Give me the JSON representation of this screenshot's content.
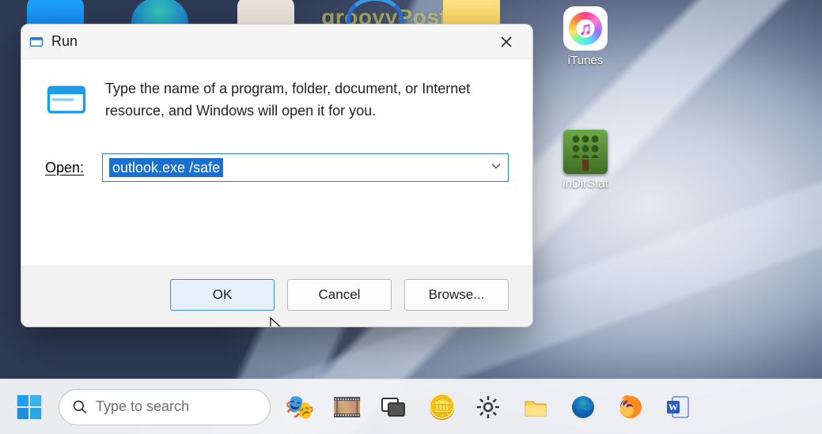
{
  "watermark": "groovyPost.com",
  "desktop_icons": {
    "itunes": "iTunes",
    "windirstat": "inDirStat"
  },
  "run_dialog": {
    "title": "Run",
    "description": "Type the name of a program, folder, document, or Internet resource, and Windows will open it for you.",
    "open_label": "Open:",
    "command_value": "outlook.exe /safe",
    "buttons": {
      "ok": "OK",
      "cancel": "Cancel",
      "browse": "Browse..."
    }
  },
  "taskbar": {
    "search_placeholder": "Type to search",
    "icons": {
      "start": "start-icon",
      "search": "search-icon",
      "drama_masks": "drama-masks-icon",
      "film": "film-reel-icon",
      "task_view": "task-view-icon",
      "coins": "coin-stack-icon",
      "settings": "settings-gear-icon",
      "explorer": "file-explorer-icon",
      "edge": "edge-icon",
      "firefox": "firefox-icon",
      "word": "word-icon"
    }
  },
  "colors": {
    "selection": "#1b6fd0",
    "dialog_border": "#2a7ecb",
    "primary_btn_bg": "#e5f0fb"
  }
}
